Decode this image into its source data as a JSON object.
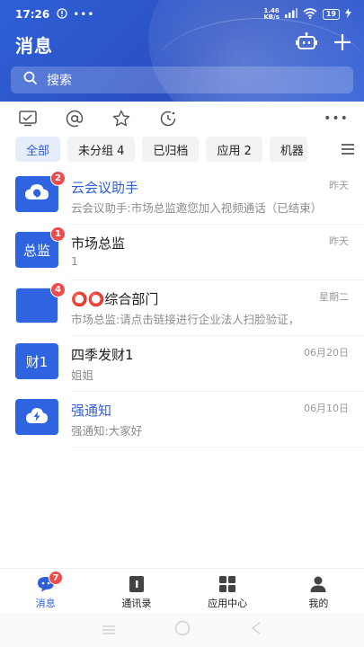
{
  "status_bar": {
    "time": "17:26",
    "net_speed_value": "1.46",
    "net_speed_unit": "KB/s",
    "battery": "19"
  },
  "header": {
    "title": "消息",
    "search_placeholder": "搜索"
  },
  "quick_icons": [
    "approval-icon",
    "mention-icon",
    "star-icon",
    "later-icon",
    "more-icon"
  ],
  "filters": [
    {
      "label": "全部",
      "active": true
    },
    {
      "label": "未分组 4",
      "active": false
    },
    {
      "label": "已归档",
      "active": false
    },
    {
      "label": "应用 2",
      "active": false
    },
    {
      "label": "机器",
      "active": false
    }
  ],
  "conversations": [
    {
      "name": "云会议助手",
      "preview": "云会议助手:市场总监邀您加入视频通话（已结束）",
      "time": "昨天",
      "badge": "2",
      "avatar_icon": "cloud-meeting-icon"
    },
    {
      "name": "市场总监",
      "preview": "1",
      "time": "昨天",
      "badge": "1",
      "avatar_text": "总监"
    },
    {
      "name": "⭕⭕综合部门",
      "preview": "市场总监:请点击链接进行企业法人扫脸验证，",
      "time": "星期二",
      "badge": "4",
      "avatar_icon": "group-grid-icon"
    },
    {
      "name": "四季发财1",
      "preview": "姐姐",
      "time": "06月20日",
      "avatar_text": "财1"
    },
    {
      "name": "强通知",
      "preview": "强通知:大家好",
      "time": "06月10日",
      "avatar_icon": "lightning-icon"
    }
  ],
  "tabs": [
    {
      "label": "消息",
      "badge": "7",
      "active": true
    },
    {
      "label": "通讯录"
    },
    {
      "label": "应用中心"
    },
    {
      "label": "我的"
    }
  ],
  "colors": {
    "primary": "#2f5fd6",
    "badge": "#ef4b4b"
  }
}
